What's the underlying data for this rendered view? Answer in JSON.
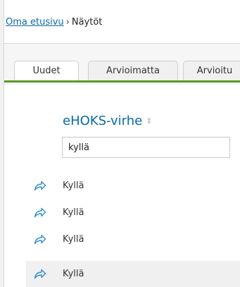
{
  "breadcrumb": {
    "home_link": "Oma etusivu",
    "separator": "›",
    "current": "Näytöt"
  },
  "tabs": [
    {
      "label": "Uudet",
      "active": true
    },
    {
      "label": "Arvioimatta",
      "active": false
    },
    {
      "label": "Arvioitu",
      "active": false
    }
  ],
  "table": {
    "column_header": "eHOKS-virhe",
    "sort_icon": "sort-icon",
    "filter_value": "kyllä",
    "rows": [
      {
        "value": "Kyllä",
        "icon": "share-arrow-icon",
        "highlighted": false
      },
      {
        "value": "Kyllä",
        "icon": "share-arrow-icon",
        "highlighted": false
      },
      {
        "value": "Kyllä",
        "icon": "share-arrow-icon",
        "highlighted": false
      },
      {
        "value": "Kyllä",
        "icon": "share-arrow-icon",
        "highlighted": true
      }
    ]
  },
  "colors": {
    "link": "#0a6aa8",
    "tab_underline": "#5a9a26",
    "icon": "#2f8fd0",
    "row_highlight": "#f0f0f0"
  }
}
